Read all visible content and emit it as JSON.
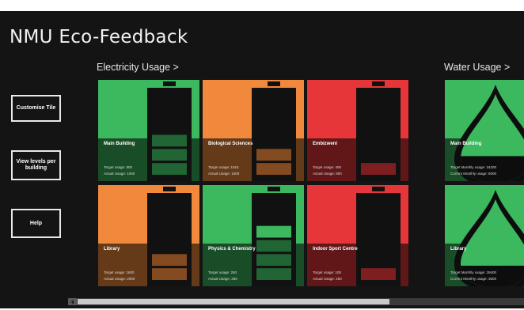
{
  "app": {
    "title": "NMU  Eco-Feedback"
  },
  "groups": [
    {
      "label": "Electricity Usage >"
    },
    {
      "label": "Water Usage >"
    }
  ],
  "sidebar": {
    "buttons": [
      {
        "label": "Customise Tile"
      },
      {
        "label": "View levels per building"
      },
      {
        "label": "Help"
      }
    ]
  },
  "colors": {
    "green": "#3cb85e",
    "orange": "#f0893c",
    "red": "#e7363a",
    "background": "#141414"
  },
  "tiles": [
    {
      "name": "Main Building",
      "line1": "Target usage: 800",
      "line2": "Actual Usage: 1000",
      "status": "green",
      "icon": "battery-icon",
      "level": 0.5,
      "selected": true
    },
    {
      "name": "Biological Sciences",
      "line1": "Target usage: 1015",
      "line2": "Actual Usage: 1500",
      "status": "orange",
      "icon": "battery-icon",
      "level": 0.33,
      "selected": false
    },
    {
      "name": "Embizweni",
      "line1": "Target usage: 400",
      "line2": "Actual Usage: 800",
      "status": "red",
      "icon": "battery-icon",
      "level": 0.17,
      "selected": false
    },
    {
      "name": "Library",
      "line1": "Target usage: 1600",
      "line2": "Actual Usage: 2000",
      "status": "orange",
      "icon": "battery-icon",
      "level": 0.33,
      "selected": false
    },
    {
      "name": "Physics & Chemistry",
      "line1": "Target usage: 250",
      "line2": "Actual Usage: 250",
      "status": "green",
      "icon": "battery-icon",
      "level": 0.67,
      "selected": false
    },
    {
      "name": "Indoor Sport Centre",
      "line1": "Target usage: 100",
      "line2": "Actual Usage: 250",
      "status": "red",
      "icon": "battery-icon",
      "level": 0.17,
      "selected": false
    },
    {
      "name": "Main Building",
      "line1": "Target Monthly usage: 34200",
      "line2": "Current Monthly usage: 6000",
      "status": "green",
      "icon": "water-drop-icon",
      "level": 0.3,
      "selected": false
    },
    {
      "name": "Library",
      "line1": "Target Monthly usage: 29400",
      "line2": "Current Monthly usage: 3500",
      "status": "green",
      "icon": "water-drop-icon",
      "level": 0.25,
      "selected": false
    }
  ],
  "scrollbar": {
    "position": 0
  }
}
